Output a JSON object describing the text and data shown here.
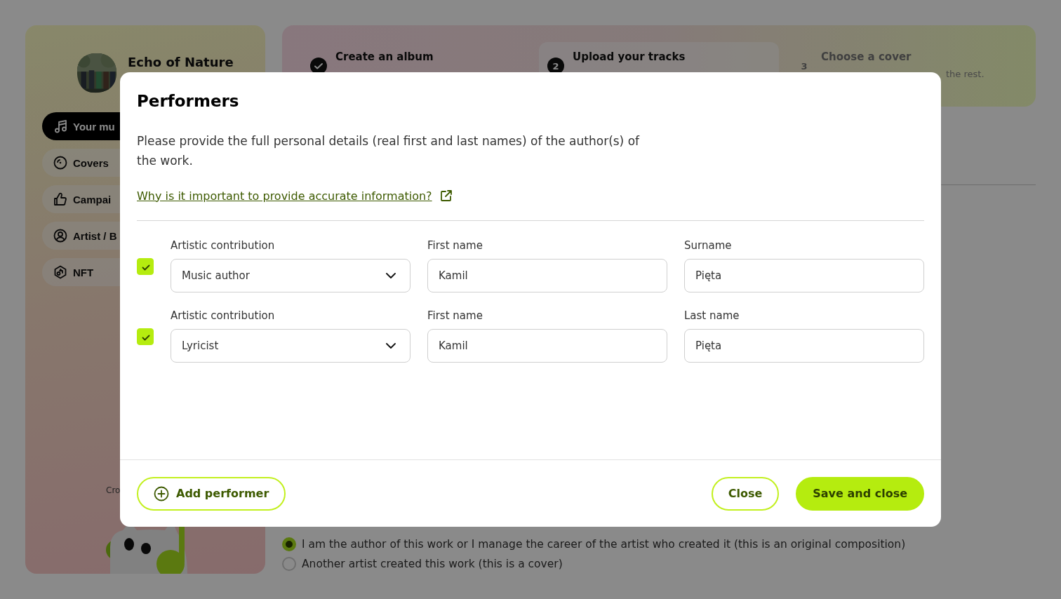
{
  "sidebar": {
    "artist_name": "Echo of Nature",
    "items": [
      {
        "label": "Your mu",
        "selected": true
      },
      {
        "label": "Covers",
        "selected": false
      },
      {
        "label": "Campai",
        "selected": false
      },
      {
        "label": "Artist / B",
        "selected": false
      },
      {
        "label": "NFT",
        "selected": false
      }
    ],
    "footer_text": "Cro"
  },
  "steps": [
    {
      "kind": "done",
      "label": "Create an album"
    },
    {
      "kind": "current",
      "number": "2",
      "label": "Upload your tracks"
    },
    {
      "kind": "upcoming",
      "number": "3",
      "label": "Choose a cover",
      "description": "the rest."
    }
  ],
  "origin_options": [
    {
      "label": "I am the author of this work or I manage the career of the artist who created it (this is an original composition)",
      "selected": true
    },
    {
      "label": "Another artist created this work (this is a cover)",
      "selected": false
    }
  ],
  "modal": {
    "title": "Performers",
    "description": "Please provide the full personal details (real first and last names) of the author(s) of the work.",
    "info_link": "Why is it important to provide accurate information?",
    "performers": [
      {
        "checked": true,
        "fields": [
          {
            "kind": "select",
            "label": "Artistic contribution",
            "value": "Music author"
          },
          {
            "kind": "text",
            "label": "First name",
            "value": "Kamil"
          },
          {
            "kind": "text",
            "label": "Surname",
            "value": "Pięta"
          }
        ]
      },
      {
        "checked": true,
        "fields": [
          {
            "kind": "select",
            "label": "Artistic contribution",
            "value": "Lyricist"
          },
          {
            "kind": "text",
            "label": "First name",
            "value": "Kamil"
          },
          {
            "kind": "text",
            "label": "Last name",
            "value": "Pięta"
          }
        ]
      }
    ],
    "add_button": "Add performer",
    "close_button": "Close",
    "save_button": "Save and close"
  }
}
